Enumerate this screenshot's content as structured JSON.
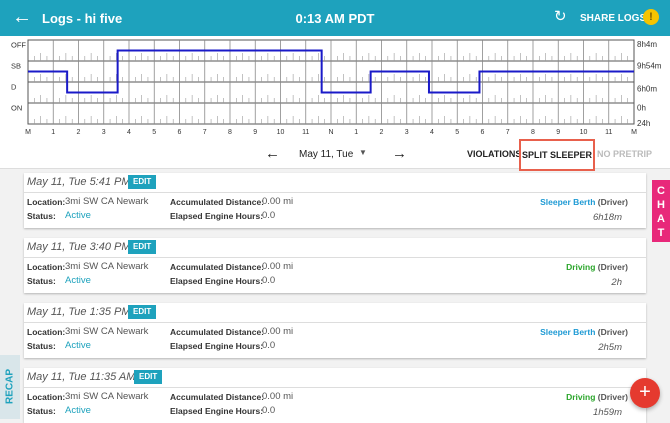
{
  "header": {
    "back_icon": "arrow-left-icon",
    "title": "Logs - hi five",
    "clock": "0:13 AM PDT",
    "refresh_icon": "refresh-icon",
    "share_label": "SHARE LOGS",
    "alert_symbol": "!",
    "alert_color": "#f5c400",
    "bar_color": "#1ea2bd"
  },
  "graph": {
    "status_rows": [
      "OFF",
      "SB",
      "D",
      "ON"
    ],
    "hour_labels": [
      "M",
      "1",
      "2",
      "3",
      "4",
      "5",
      "6",
      "7",
      "8",
      "9",
      "10",
      "11",
      "N",
      "1",
      "2",
      "3",
      "4",
      "5",
      "6",
      "7",
      "8",
      "9",
      "10",
      "11",
      "M"
    ],
    "totals": [
      "8h4m",
      "9h54m",
      "6h0m",
      "0h",
      "24h"
    ],
    "line_color": "#1a1ac8",
    "segments": [
      {
        "status": "SB",
        "start_hour": 0.0,
        "end_hour": 1.55
      },
      {
        "status": "D",
        "start_hour": 1.55,
        "end_hour": 3.55
      },
      {
        "status": "OFF",
        "start_hour": 3.55,
        "end_hour": 11.63
      },
      {
        "status": "D",
        "start_hour": 11.63,
        "end_hour": 13.57
      },
      {
        "status": "SB",
        "start_hour": 13.57,
        "end_hour": 15.88
      },
      {
        "status": "D",
        "start_hour": 15.88,
        "end_hour": 17.88
      },
      {
        "status": "SB",
        "start_hour": 17.88,
        "end_hour": 24.0
      }
    ]
  },
  "datebar": {
    "prev_icon": "arrow-left-icon",
    "date": "May 11, Tue",
    "caret": "▼",
    "next_icon": "arrow-right-icon",
    "violations_label": "VIOLATIONS",
    "split_label": "SPLIT SLEEPER",
    "nopretrip_label": "NO PRETRIP"
  },
  "labels": {
    "edit": "EDIT",
    "location": "Location:",
    "status": "Status:",
    "distance": "Accumulated Distance:",
    "engine": "Elapsed Engine Hours:"
  },
  "events": [
    {
      "time": "May 11, Tue 5:41 PM",
      "location": "3mi SW CA Newark",
      "status": "Active",
      "distance": "0.00 mi",
      "engine": "0.0",
      "duty": "Sleeper Berth",
      "role": "(Driver)",
      "duration": "6h18m"
    },
    {
      "time": "May 11, Tue 3:40 PM",
      "location": "3mi SW CA Newark",
      "status": "Active",
      "distance": "0.00 mi",
      "engine": "0.0",
      "duty": "Driving",
      "role": "(Driver)",
      "duration": "2h"
    },
    {
      "time": "May 11, Tue 1:35 PM",
      "location": "3mi SW CA Newark",
      "status": "Active",
      "distance": "0.00 mi",
      "engine": "0.0",
      "duty": "Sleeper Berth",
      "role": "(Driver)",
      "duration": "2h5m"
    },
    {
      "time": "May 11, Tue 11:35 AM",
      "location": "3mi SW CA Newark",
      "status": "Active",
      "distance": "0.00 mi",
      "engine": "0.0",
      "duty": "Driving",
      "role": "(Driver)",
      "duration": "1h59m"
    }
  ],
  "side": {
    "chat_label": "CHAT",
    "chat_color": "#e8287a",
    "recap_label": "RECAP",
    "fab_symbol": "+",
    "fab_color": "#e53a2f"
  }
}
